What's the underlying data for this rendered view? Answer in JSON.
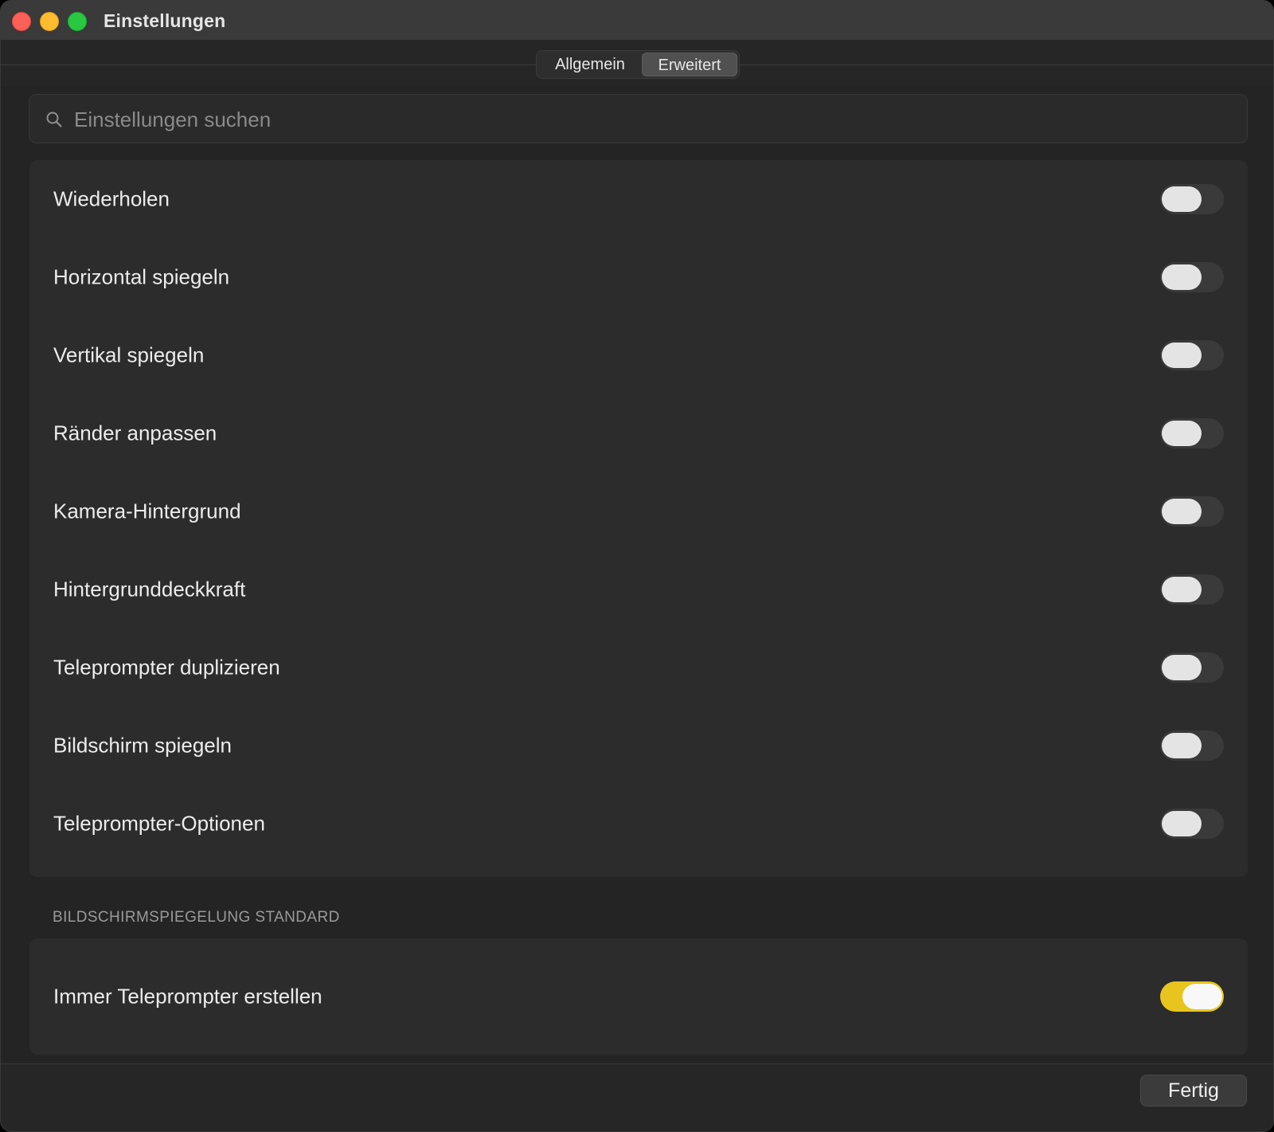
{
  "window": {
    "title": "Einstellungen"
  },
  "tabs": [
    {
      "label": "Allgemein",
      "selected": false
    },
    {
      "label": "Erweitert",
      "selected": true
    }
  ],
  "search": {
    "placeholder": "Einstellungen suchen",
    "value": ""
  },
  "settings_group": {
    "rows": [
      {
        "label": "Wiederholen",
        "enabled": false
      },
      {
        "label": "Horizontal spiegeln",
        "enabled": false
      },
      {
        "label": "Vertikal spiegeln",
        "enabled": false
      },
      {
        "label": "Ränder anpassen",
        "enabled": false
      },
      {
        "label": "Kamera-Hintergrund",
        "enabled": false
      },
      {
        "label": "Hintergrunddeckkraft",
        "enabled": false
      },
      {
        "label": "Teleprompter duplizieren",
        "enabled": false
      },
      {
        "label": "Bildschirm spiegeln",
        "enabled": false
      },
      {
        "label": "Teleprompter-Optionen",
        "enabled": false
      }
    ]
  },
  "mirroring_section": {
    "header": "BILDSCHIRMSPIEGELUNG STANDARD",
    "rows": [
      {
        "label": "Immer Teleprompter erstellen",
        "enabled": true
      }
    ]
  },
  "footer": {
    "done_label": "Fertig"
  },
  "colors": {
    "accent_toggle_on": "#e7c51e",
    "window_background": "#242424",
    "group_background": "#2c2c2c"
  }
}
